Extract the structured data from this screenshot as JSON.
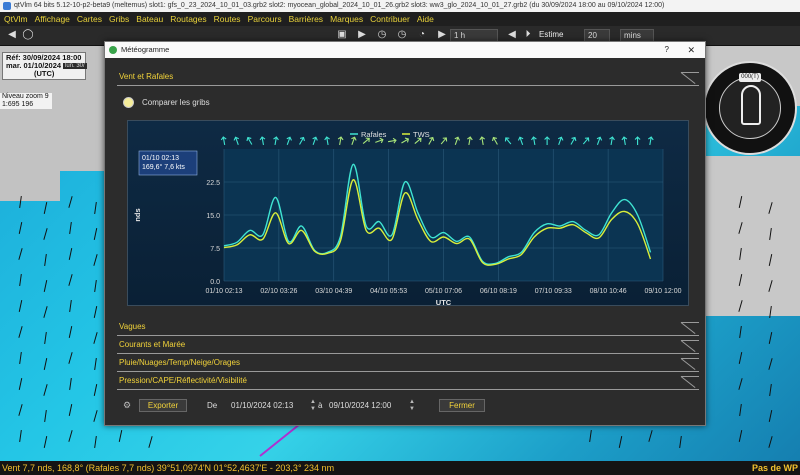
{
  "window": {
    "title": "qtVlm 64 bits 5.12-10-p2-beta9 (meltemus) slot1: gfs_0_23_2024_10_01_03.grb2 slot2: myocean_global_2024_10_01_26.grb2 slot3: ww3_glo_2024_10_01_27.grb2 (du 30/09/2024 18:00 au 09/10/2024 12:00)"
  },
  "menu": [
    "QtVlm",
    "Affichage",
    "Cartes",
    "Gribs",
    "Bateau",
    "Routages",
    "Routes",
    "Parcours",
    "Barrières",
    "Marques",
    "Contribuer",
    "Aide"
  ],
  "toolbar": {
    "time_step": "1 h",
    "mode": "Estime",
    "value": "20",
    "unit": "mins"
  },
  "map": {
    "ref_line1": "Réf: 30/09/2024 18:00",
    "ref_line2": "mar. 01/10/2024 02:13",
    "ref_line3": "(UTC)",
    "tooltip_date": "lun. 30/",
    "zoom_label": "Niveau zoom 9",
    "scale_label": "1:695 196",
    "compass_heading": "000(T)"
  },
  "dialog": {
    "title": "Météogramme",
    "help": "?",
    "close": "✕",
    "section_wind": "Vent et Rafales",
    "compare_label": "Comparer les gribs",
    "sections_collapsed": [
      "Vagues",
      "Courants et Marée",
      "Pluie/Nuages/Temp/Neige/Orages",
      "Pression/CAPE/Réflectivité/Visibilité"
    ],
    "export_label": "Exporter",
    "from_label": "De",
    "from_value": "01/10/2024 02:13",
    "to_label": "à",
    "to_value": "09/10/2024 12:00",
    "close_label": "Fermer"
  },
  "chart_data": {
    "type": "line",
    "title": "",
    "xlabel": "UTC",
    "ylabel": "nds",
    "ylim": [
      0,
      30
    ],
    "yticks": [
      "0.0",
      "7.5",
      "15.0",
      "22.5"
    ],
    "xticks": [
      "01/10 02:13",
      "02/10 03:26",
      "03/10 04:39",
      "04/10 05:53",
      "05/10 07:06",
      "06/10 08:19",
      "07/10 09:33",
      "08/10 10:46",
      "09/10 12:00"
    ],
    "legend": [
      "Rafales",
      "TWS"
    ],
    "tooltip": [
      "01/10 02:13",
      "169,6° 7,6 kts"
    ],
    "x_hours": [
      0,
      6,
      12,
      18,
      24,
      30,
      36,
      42,
      48,
      54,
      60,
      66,
      72,
      78,
      84,
      90,
      96,
      102,
      108,
      114,
      120,
      126,
      132,
      138,
      144,
      150,
      156,
      162,
      168,
      174,
      180,
      186,
      192,
      198,
      203.8
    ],
    "series": [
      {
        "name": "Rafales",
        "values": [
          8.0,
          8.8,
          11.5,
          10.5,
          19.0,
          9.0,
          12.5,
          7.0,
          6.5,
          10.0,
          26.5,
          12.5,
          13.5,
          10.5,
          22.5,
          15.5,
          10.0,
          11.0,
          9.0,
          10.0,
          4.5,
          4.0,
          5.5,
          6.5,
          11.0,
          13.0,
          12.5,
          13.5,
          11.5,
          10.5,
          15.5,
          18.5,
          15.0,
          6.5
        ],
        "color": "#3fe4d2"
      },
      {
        "name": "TWS",
        "values": [
          7.6,
          8.2,
          10.5,
          9.5,
          15.5,
          8.5,
          11.5,
          6.8,
          6.3,
          9.0,
          23.0,
          11.5,
          12.0,
          9.5,
          20.0,
          14.0,
          9.0,
          10.0,
          8.5,
          9.5,
          4.2,
          3.8,
          5.0,
          6.0,
          10.0,
          12.0,
          12.0,
          12.8,
          11.0,
          9.8,
          14.0,
          15.8,
          13.0,
          5.0
        ],
        "color": "#d9ef3a"
      }
    ],
    "wind_directions_deg": [
      170,
      160,
      150,
      170,
      190,
      200,
      210,
      200,
      170,
      190,
      200,
      230,
      250,
      260,
      240,
      230,
      210,
      220,
      200,
      190,
      170,
      150,
      140,
      160,
      170,
      180,
      200,
      210,
      220,
      200,
      190,
      170,
      180,
      190
    ]
  }
}
